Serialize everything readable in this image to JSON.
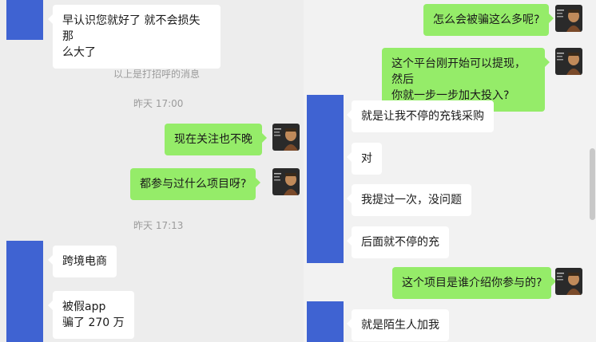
{
  "left": {
    "system": {
      "greeting_note": "以上是打招呼的消息",
      "time_1": "昨天 17:00",
      "time_2": "昨天 17:13"
    },
    "messages": [
      {
        "text": "早认识您就好了 就不会损失那\n么大了"
      },
      {
        "text": "现在关注也不晚"
      },
      {
        "text": "都参与过什么项目呀?"
      },
      {
        "text": "跨境电商"
      },
      {
        "text": "被假app\n骗了 270 万"
      }
    ]
  },
  "right": {
    "messages": [
      {
        "text": "怎么会被骗这么多呢?"
      },
      {
        "text": "这个平台刚开始可以提现，然后\n你就一步一步加大投入?"
      },
      {
        "text": "就是让我不停的充钱采购"
      },
      {
        "text": "对"
      },
      {
        "text": "我提过一次，没问题"
      },
      {
        "text": "后面就不停的充"
      },
      {
        "text": "这个项目是谁介绍你参与的?"
      },
      {
        "text": "就是陌生人加我"
      }
    ]
  },
  "colors": {
    "outgoing_bubble": "#95ec69",
    "incoming_bubble": "#ffffff",
    "redaction_block": "#3f63d2",
    "background": "#ededed"
  },
  "icons": {
    "self_avatar": "avatar-photo-icon",
    "contact_avatar": "redacted-avatar-block"
  }
}
